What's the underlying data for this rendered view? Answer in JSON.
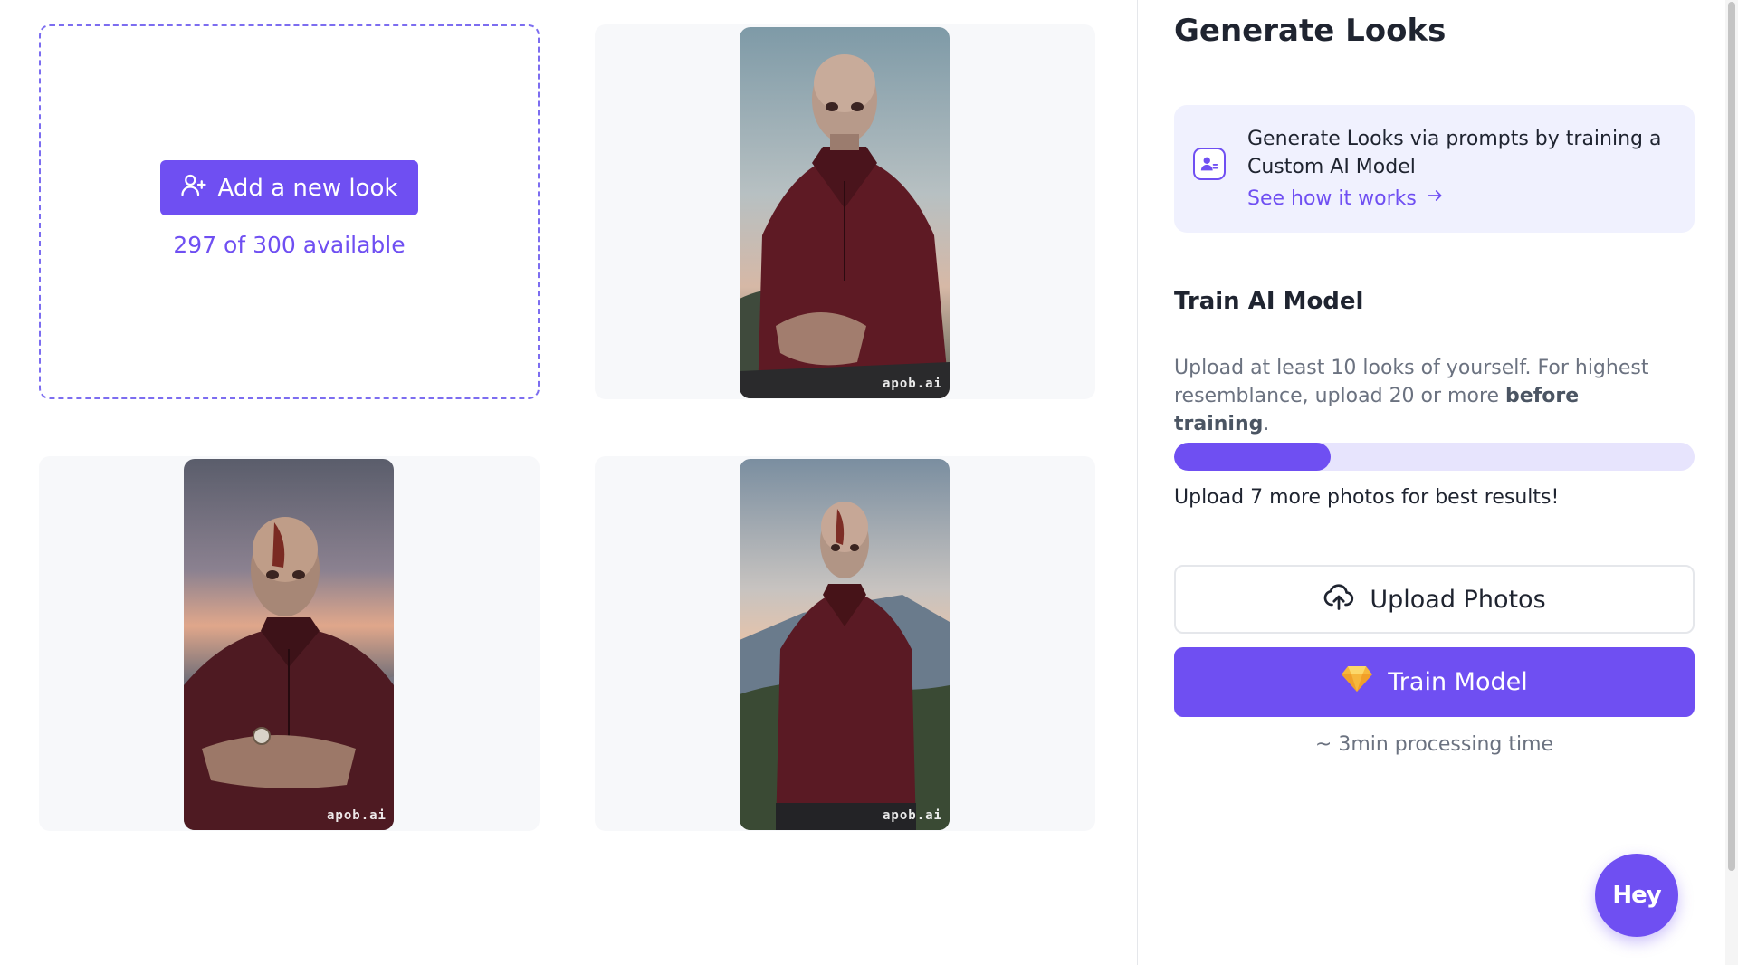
{
  "grid": {
    "add_card": {
      "button_label": "Add a new look",
      "button_icon": "user-plus-icon",
      "availability": "297 of 300 available"
    },
    "photos": [
      {
        "watermark": "apob.ai"
      },
      {
        "watermark": "apob.ai"
      },
      {
        "watermark": "apob.ai"
      }
    ]
  },
  "panel": {
    "title": "Generate Looks",
    "info": {
      "icon": "user-card-icon",
      "text": "Generate Looks via prompts by training a Custom AI Model",
      "link_label": "See how it works",
      "link_icon": "arrow-right-icon"
    },
    "train": {
      "title": "Train AI Model",
      "description_prefix": "Upload at least 10 looks of yourself. For highest resemblance, upload 20 or more",
      "description_bold": "before training",
      "description_suffix": ".",
      "progress": 0.3,
      "hint": "Upload 7 more photos for best results!",
      "upload_label": "Upload Photos",
      "upload_icon": "cloud-upload-icon",
      "train_label": "Train Model",
      "train_icon": "diamond-icon",
      "time_note": "~ 3min processing time"
    },
    "chat_label": "Hey"
  },
  "colors": {
    "accent": "#6f4ff2",
    "accent_light": "#f0f1fe",
    "progress_track": "#e7e4fd",
    "card_bg": "#f7f8fa"
  }
}
